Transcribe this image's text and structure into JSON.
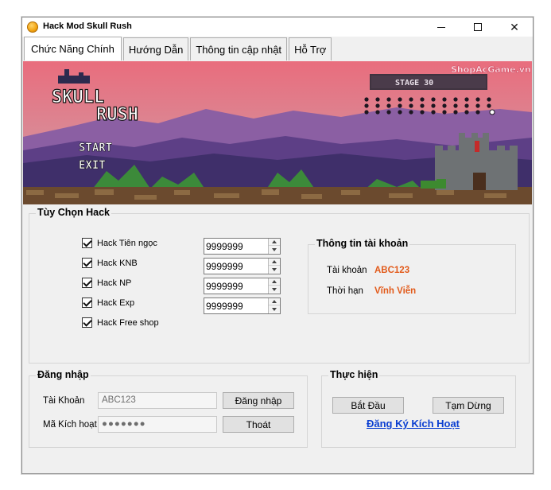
{
  "window": {
    "title": "Hack Mod Skull Rush"
  },
  "tabs": [
    "Chức Năng Chính",
    "Hướng Dẫn",
    "Thông tin cập nhật",
    "Hỗ Trợ"
  ],
  "banner": {
    "game_title_line1": "SKULL",
    "game_title_line2": "RUSH",
    "menu_start": "START",
    "menu_exit": "EXIT",
    "stage_label": "STAGE 30",
    "watermark": "ShopAcGame.vn"
  },
  "hack_options": {
    "title": "Tùy Chọn Hack",
    "items": [
      {
        "label": "Hack Tiên ngọc",
        "checked": true,
        "value": "9999999"
      },
      {
        "label": "Hack KNB",
        "checked": true,
        "value": "9999999"
      },
      {
        "label": "Hack NP",
        "checked": true,
        "value": "9999999"
      },
      {
        "label": "Hack Exp",
        "checked": true,
        "value": "9999999"
      },
      {
        "label": "Hack Free shop",
        "checked": true
      }
    ]
  },
  "account_info": {
    "title": "Thông tin tài khoản",
    "account_label": "Tài khoản",
    "account_value": "ABC123",
    "expiry_label": "Thời hạn",
    "expiry_value": "Vĩnh Viễn"
  },
  "login": {
    "title": "Đăng nhập",
    "account_label": "Tài Khoản",
    "account_value": "ABC123",
    "code_label": "Mã Kích hoạt",
    "code_value": "●●●●●●●",
    "login_button": "Đăng nhập",
    "exit_button": "Thoát"
  },
  "execute": {
    "title": "Thực hiện",
    "start_button": "Bắt Đầu",
    "pause_button": "Tạm Dừng",
    "register_link": "Đăng Ký Kích Hoạt"
  },
  "colors": {
    "accent_value": "#e25a1a",
    "link": "#0b3fd1",
    "window_bg": "#f0f0f0"
  }
}
